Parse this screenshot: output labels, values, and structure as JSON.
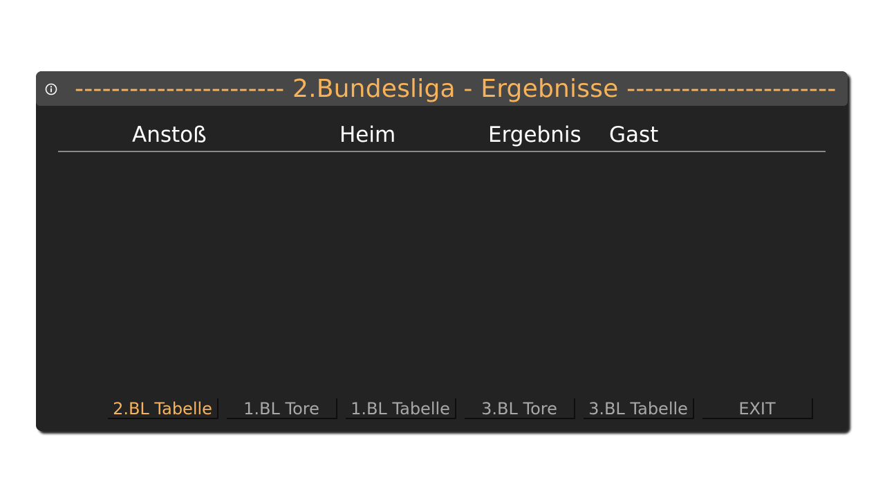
{
  "window": {
    "title": "----------------------- 2.Bundesliga - Ergebnisse -----------------------",
    "info_icon": "info-circle-icon"
  },
  "table": {
    "headers": {
      "kickoff": "Anstoß",
      "home": "Heim",
      "result": "Ergebnis",
      "away": "Gast"
    },
    "rows": []
  },
  "buttons": [
    {
      "label": "2.BL Tabelle",
      "active": true
    },
    {
      "label": "1.BL Tore",
      "active": false
    },
    {
      "label": "1.BL Tabelle",
      "active": false
    },
    {
      "label": "3.BL Tore",
      "active": false
    },
    {
      "label": "3.BL Tabelle",
      "active": false
    },
    {
      "label": "EXIT",
      "active": false
    }
  ],
  "colors": {
    "accent": "#f6b35c",
    "background": "#232323",
    "titlebar": "#474747",
    "button_text": "#a8a8a8",
    "header_text": "#ffffff"
  }
}
